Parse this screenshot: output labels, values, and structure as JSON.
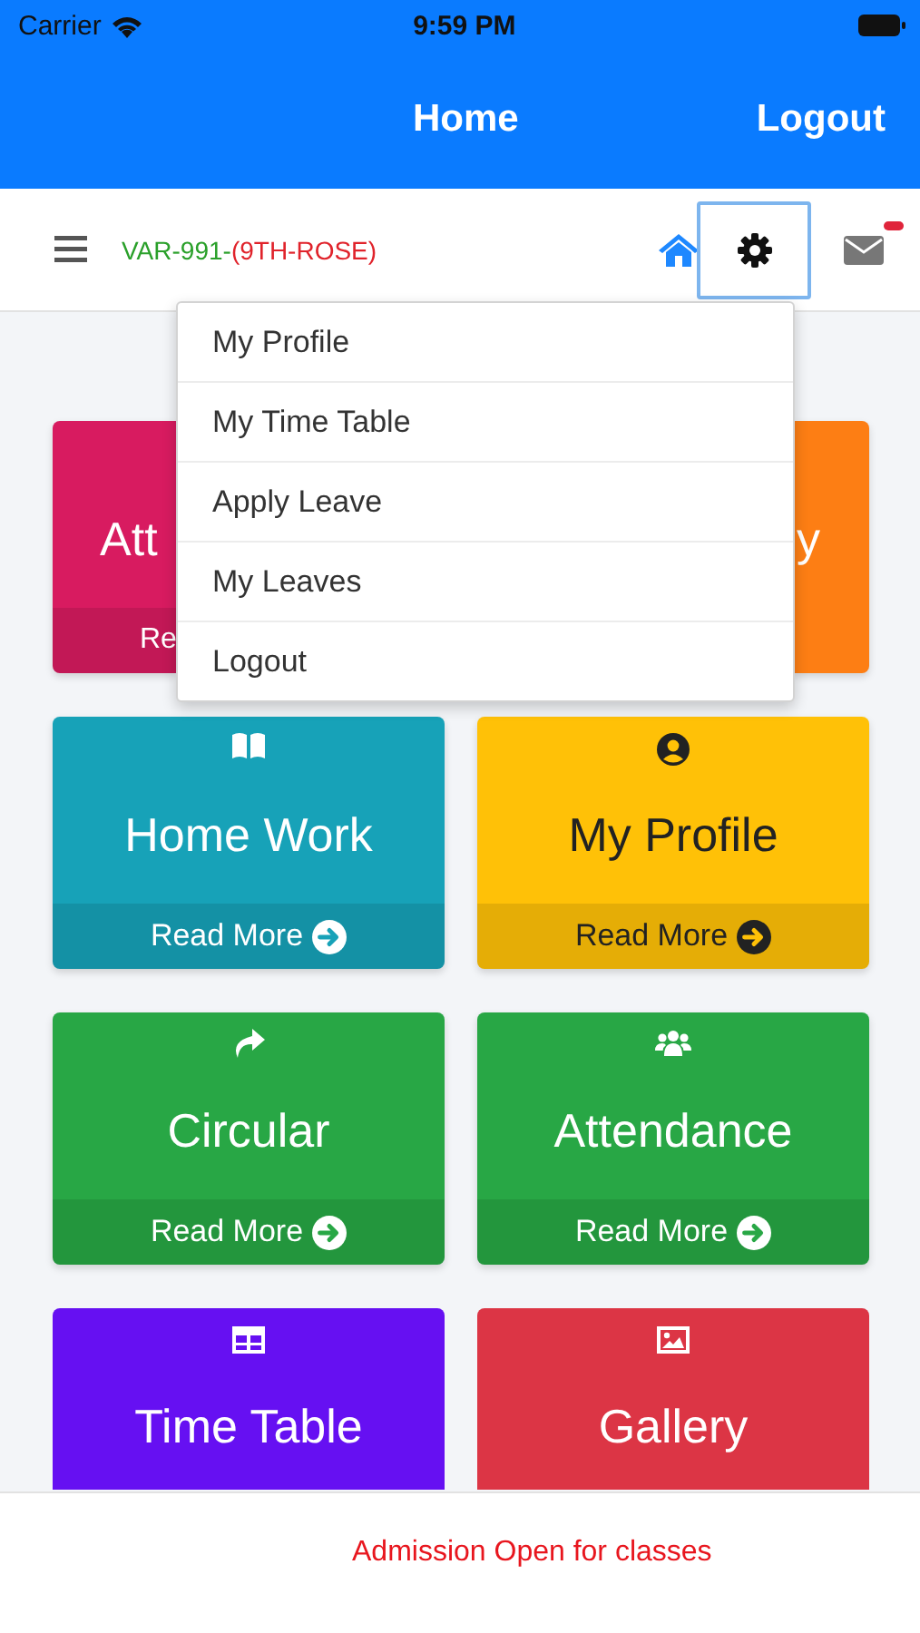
{
  "status_bar": {
    "carrier": "Carrier",
    "time": "9:59 PM"
  },
  "nav_bar": {
    "title": "Home",
    "action": "Logout"
  },
  "toolbar": {
    "code": "VAR-991-",
    "class_name": "(9TH-ROSE)",
    "settings_selected": true,
    "mail_unread": true
  },
  "menu": [
    {
      "label": "My Profile"
    },
    {
      "label": "My Time Table"
    },
    {
      "label": "Apply Leave"
    },
    {
      "label": "My Leaves"
    },
    {
      "label": "Logout"
    }
  ],
  "cards": [
    {
      "title": "Att",
      "link": "Re",
      "color": "#d81b60",
      "dark_text": false,
      "kind": "covered-left"
    },
    {
      "title": "y",
      "color": "#fd7e14",
      "dark_text": false,
      "kind": "covered-right"
    },
    {
      "title": "Home Work",
      "link": "Read More",
      "color": "#17a2b8",
      "dark_text": false,
      "kind": "book"
    },
    {
      "title": "My Profile",
      "link": "Read More",
      "color": "#ffc107",
      "dark_text": true,
      "kind": "user"
    },
    {
      "title": "Circular",
      "link": "Read More",
      "color": "#28a745",
      "dark_text": false,
      "kind": "share"
    },
    {
      "title": "Attendance",
      "link": "Read More",
      "color": "#28a745",
      "dark_text": false,
      "kind": "users"
    },
    {
      "title": "Time Table",
      "color": "#6610f2",
      "dark_text": false,
      "kind": "table",
      "cut_off": true
    },
    {
      "title": "Gallery",
      "color": "#dc3545",
      "dark_text": false,
      "kind": "image",
      "cut_off": true
    }
  ],
  "footer": {
    "notice": "Admission Open for classes"
  }
}
